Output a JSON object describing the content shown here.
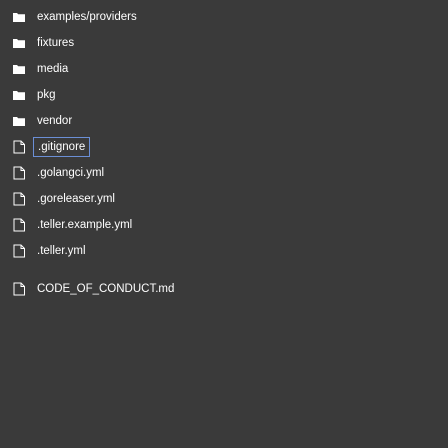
{
  "file_tree": {
    "items": [
      {
        "type": "folder",
        "icon": "folder-icon",
        "label": "examples/providers"
      },
      {
        "type": "folder",
        "icon": "folder-icon",
        "label": "fixtures"
      },
      {
        "type": "folder",
        "icon": "folder-icon",
        "label": "media"
      },
      {
        "type": "folder",
        "icon": "folder-icon",
        "label": "pkg"
      },
      {
        "type": "folder",
        "icon": "folder-icon",
        "label": "vendor"
      },
      {
        "type": "file",
        "icon": "file-icon",
        "label": ".gitignore",
        "selected": true
      },
      {
        "type": "file",
        "icon": "file-icon",
        "label": ".golangci.yml"
      },
      {
        "type": "file",
        "icon": "file-icon",
        "label": ".goreleaser.yml"
      },
      {
        "type": "file",
        "icon": "file-icon",
        "label": ".teller.example.yml"
      },
      {
        "type": "file",
        "icon": "file-icon",
        "label": ".teller.yml"
      },
      {
        "type": "file",
        "icon": "file-icon",
        "label": "CODE_OF_CONDUCT.md"
      }
    ]
  },
  "colors": {
    "background": "#3a3a3a",
    "text": "#ffffff",
    "folder_icon": "#ffffff",
    "file_icon": "#ffffff",
    "selection_border": "#6b8fd6"
  }
}
